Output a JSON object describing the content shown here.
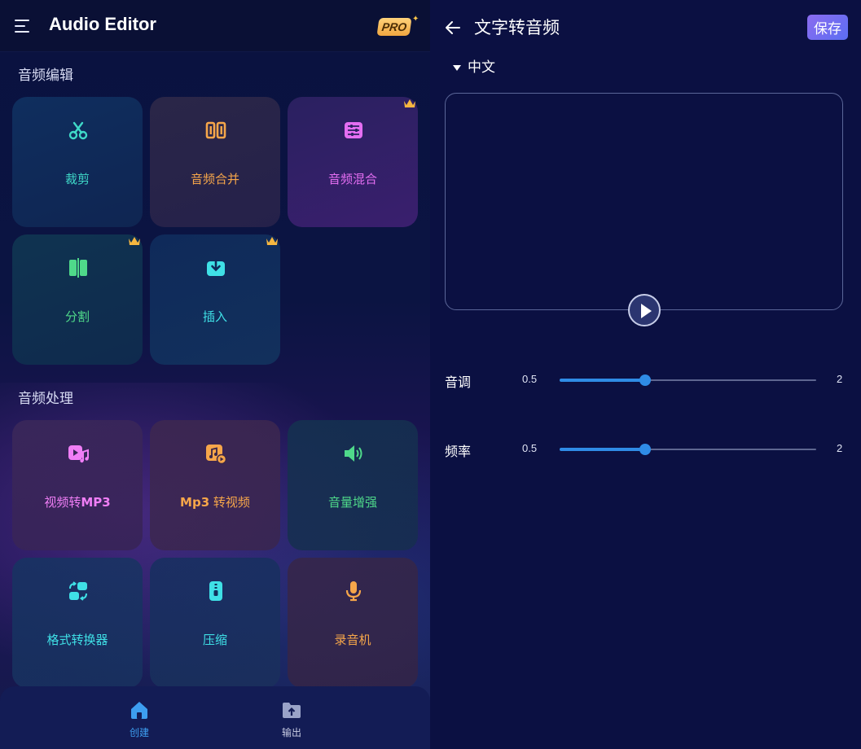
{
  "left": {
    "app_title": "Audio Editor",
    "pro_badge": "PRO",
    "section_edit": {
      "title": "音频编辑",
      "cards": [
        {
          "label": "裁剪",
          "icon": "scissors-icon",
          "color": "#3fd9c8",
          "pro": false
        },
        {
          "label": "音频合并",
          "icon": "merge-icon",
          "color": "#f6a64a",
          "pro": false
        },
        {
          "label": "音频混合",
          "icon": "mixer-icon",
          "color": "#e46ef2",
          "pro": true
        },
        {
          "label": "分割",
          "icon": "split-icon",
          "color": "#4fd98a",
          "pro": true
        },
        {
          "label": "插入",
          "icon": "insert-icon",
          "color": "#3fe0e6",
          "pro": true
        }
      ]
    },
    "section_process": {
      "title": "音频处理",
      "cards": [
        {
          "label_prefix": "视频转",
          "label_suffix": "MP3",
          "icon": "video-music-icon",
          "color": "#f07ef6"
        },
        {
          "label_prefix": "Mp3",
          "label_suffix": " 转视频",
          "icon": "music-video-icon",
          "color": "#f6a64a"
        },
        {
          "label": "音量增强",
          "icon": "volume-icon",
          "color": "#4fd98a"
        },
        {
          "label": "格式转换器",
          "icon": "convert-icon",
          "color": "#3fe0e6"
        },
        {
          "label": "压缩",
          "icon": "zip-icon",
          "color": "#3fe0e6"
        },
        {
          "label": "录音机",
          "icon": "mic-icon",
          "color": "#f6a64a"
        }
      ]
    },
    "bottom_nav": [
      {
        "label": "创建",
        "icon": "home-icon",
        "active": true
      },
      {
        "label": "输出",
        "icon": "folder-upload-icon",
        "active": false
      }
    ]
  },
  "right": {
    "title": "文字转音频",
    "save_label": "保存",
    "language": "中文",
    "text_value": "",
    "sliders": [
      {
        "label": "音调",
        "min": "0.5",
        "max": "2",
        "value": 1.0
      },
      {
        "label": "频率",
        "min": "0.5",
        "max": "2",
        "value": 1.0
      }
    ]
  },
  "colors": {
    "accent": "#2f8ce6",
    "save_gradient_start": "#8b6cf0",
    "save_gradient_end": "#5b6ef2",
    "background": "#0b1042"
  }
}
